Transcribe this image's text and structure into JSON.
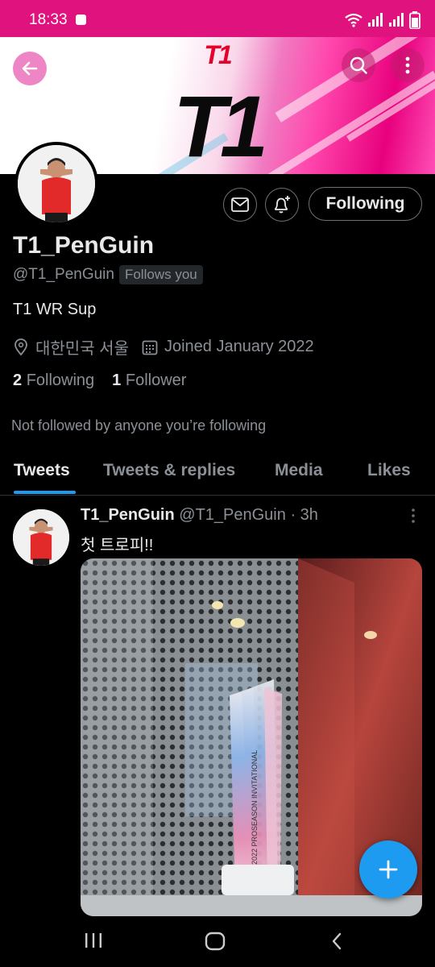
{
  "status_bar": {
    "time": "18:33"
  },
  "banner": {
    "logo_text": "T1",
    "top_logo_text": "T1"
  },
  "profile": {
    "display_name": "T1_PenGuin",
    "handle": "@T1_PenGuin",
    "follows_you": "Follows you",
    "bio": "T1 WR Sup",
    "location": "대한민국 서울",
    "joined": "Joined January 2022",
    "following_count": "2",
    "following_label": "Following",
    "followers_count": "1",
    "followers_label": "Follower",
    "not_followed_text": "Not followed by anyone you’re following"
  },
  "actions": {
    "following_button": "Following"
  },
  "tabs": [
    {
      "label": "Tweets",
      "active": true
    },
    {
      "label": "Tweets & replies",
      "active": false
    },
    {
      "label": "Media",
      "active": false
    },
    {
      "label": "Likes",
      "active": false
    }
  ],
  "tweet": {
    "author_name": "T1_PenGuin",
    "author_handle": "@T1_PenGuin",
    "separator": "·",
    "time": "3h",
    "text": "첫 트로피!!",
    "trophy_text": "2022 PROSEASON INVITATIONAL"
  },
  "colors": {
    "accent": "#1d9bf0",
    "brand_pink": "#e0127e",
    "background": "#000000",
    "secondary_text": "#8b9096"
  },
  "icons": {
    "back": "arrow-left-icon",
    "search": "search-icon",
    "more": "more-vertical-icon",
    "message": "envelope-icon",
    "notify": "bell-plus-icon",
    "location": "location-pin-icon",
    "calendar": "calendar-icon",
    "compose": "plus-icon"
  }
}
